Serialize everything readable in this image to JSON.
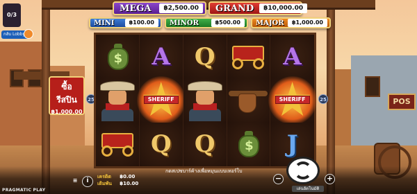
{
  "jackpots": {
    "mega": {
      "name": "MEGA",
      "value": "฿2,500.00"
    },
    "grand": {
      "name": "GRAND",
      "value": "฿10,000.00"
    },
    "mini": {
      "name": "MINI",
      "value": "฿100.00"
    },
    "minor": {
      "name": "MINOR",
      "value": "฿500.00"
    },
    "major": {
      "name": "MAJOR",
      "value": "฿1,000.00"
    }
  },
  "freespins": {
    "value": "0/3"
  },
  "lobby": {
    "label": "กลับ Lobby"
  },
  "buy_feature": {
    "line1": "ซื้อ",
    "line2": "รีสปิน",
    "price": "฿1,000.00"
  },
  "paylines": {
    "left": "25",
    "right": "25"
  },
  "reels": [
    [
      "money",
      "A",
      "Q",
      "coach",
      "A"
    ],
    [
      "cowboy",
      "sheriff",
      "cowboy",
      "holster",
      "sheriff"
    ],
    [
      "coach",
      "Q",
      "Q",
      "money",
      "J"
    ]
  ],
  "sheriff_label": "SHERIFF",
  "money_glyph": "$",
  "bottom_bar": {
    "credit_label": "เครดิต",
    "credit_value": "฿0.00",
    "bet_label": "เดิมพัน",
    "bet_value": "฿10.00",
    "hint": "กดสเปซบาร์ค้างเพื่อหมุนแบบเทอร์โบ",
    "autoplay_label": "เล่นอัตโนมัติ",
    "minus": "−",
    "plus": "+",
    "info": "i",
    "menu": "≡"
  },
  "provider": "PRAGMATIC PLAY",
  "sign_post": "POS",
  "colors": {
    "mega": "#6a2fb0",
    "grand": "#c02020",
    "mini": "#2a62c0",
    "minor": "#2a9030",
    "major": "#d87418"
  }
}
